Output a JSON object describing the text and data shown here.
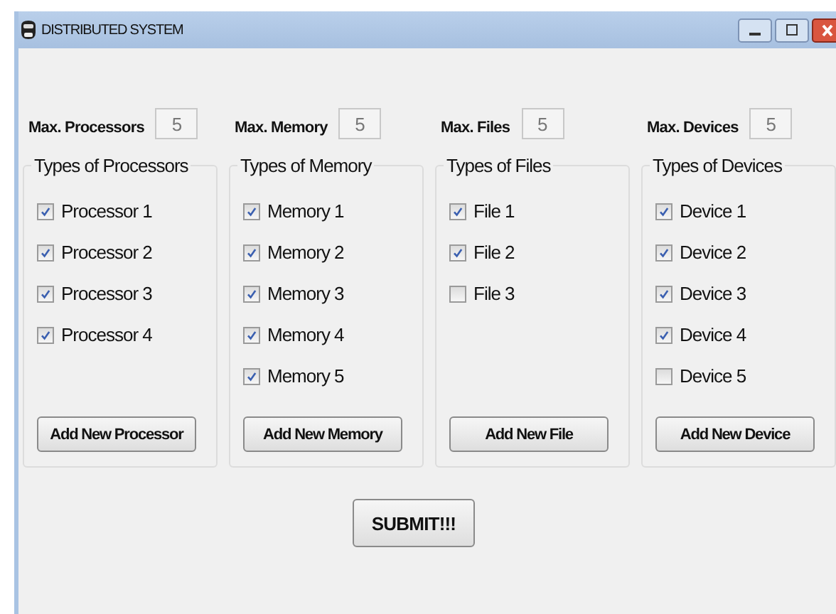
{
  "window": {
    "title": "DISTRIBUTED SYSTEM"
  },
  "limits": [
    {
      "label": "Max. Processors",
      "value": "5"
    },
    {
      "label": "Max. Memory",
      "value": "5"
    },
    {
      "label": "Max. Files",
      "value": "5"
    },
    {
      "label": "Max. Devices",
      "value": "5"
    }
  ],
  "groups": [
    {
      "title": "Types of Processors",
      "items": [
        {
          "label": "Processor 1",
          "checked": true
        },
        {
          "label": "Processor 2",
          "checked": true
        },
        {
          "label": "Processor 3",
          "checked": true
        },
        {
          "label": "Processor 4",
          "checked": true
        }
      ],
      "button": "Add New Processor"
    },
    {
      "title": "Types of Memory",
      "items": [
        {
          "label": "Memory 1",
          "checked": true
        },
        {
          "label": "Memory 2",
          "checked": true
        },
        {
          "label": "Memory 3",
          "checked": true
        },
        {
          "label": "Memory 4",
          "checked": true
        },
        {
          "label": "Memory 5",
          "checked": true
        }
      ],
      "button": "Add New Memory"
    },
    {
      "title": "Types of Files",
      "items": [
        {
          "label": "File 1",
          "checked": true
        },
        {
          "label": "File 2",
          "checked": true
        },
        {
          "label": "File 3",
          "checked": false
        }
      ],
      "button": "Add New File"
    },
    {
      "title": "Types of Devices",
      "items": [
        {
          "label": "Device 1",
          "checked": true
        },
        {
          "label": "Device 2",
          "checked": true
        },
        {
          "label": "Device 3",
          "checked": true
        },
        {
          "label": "Device 4",
          "checked": true
        },
        {
          "label": "Device 5",
          "checked": false
        }
      ],
      "button": "Add New Device"
    }
  ],
  "submit": "SUBMIT!!!"
}
